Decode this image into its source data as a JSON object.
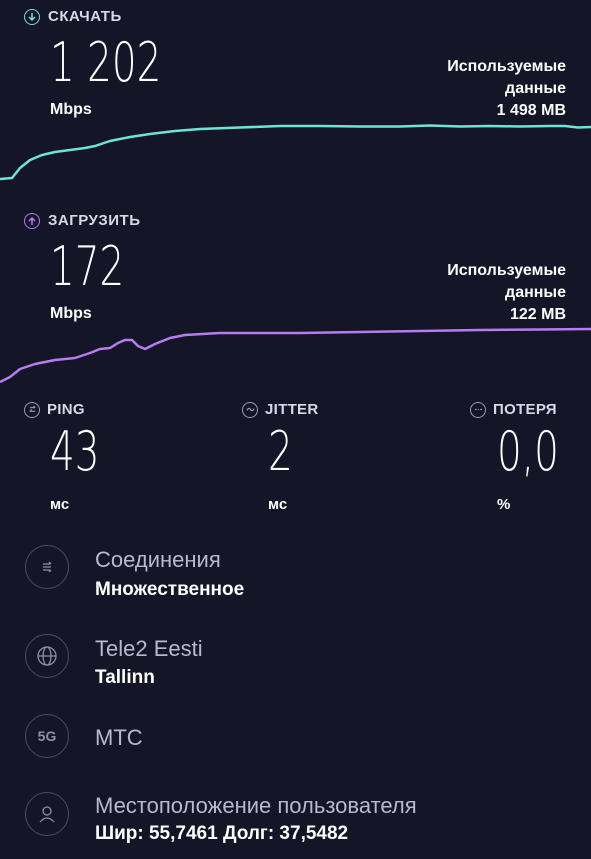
{
  "download": {
    "label": "СКАЧАТЬ",
    "value": "1 202",
    "unit": "Mbps",
    "used_line1": "Используемые",
    "used_line2": "данные",
    "used_value": "1 498 MB",
    "color": "#6fe3d6"
  },
  "upload": {
    "label": "ЗАГРУЗИТЬ",
    "value": "172",
    "unit": "Mbps",
    "used_line1": "Используемые",
    "used_line2": "данные",
    "used_value": "122 MB",
    "color": "#b87cf2"
  },
  "metrics": {
    "ping": {
      "label": "PING",
      "value": "43",
      "unit": "мс"
    },
    "jitter": {
      "label": "JITTER",
      "value": "2",
      "unit": "мс"
    },
    "loss": {
      "label": "ПОТЕРЯ",
      "value": "0,0",
      "unit": "%"
    }
  },
  "info": {
    "connections": {
      "title": "Соединения",
      "value": "Множественное",
      "icon": "connections-icon"
    },
    "provider": {
      "title": "Tele2 Eesti",
      "value": "Tallinn",
      "icon": "globe-icon"
    },
    "network": {
      "title": "МТС",
      "badge": "5G",
      "icon": "5g-icon"
    },
    "location": {
      "title": "Местоположение пользователя",
      "value": "Шир: 55,7461 Долг: 37,5482",
      "icon": "user-icon"
    }
  }
}
